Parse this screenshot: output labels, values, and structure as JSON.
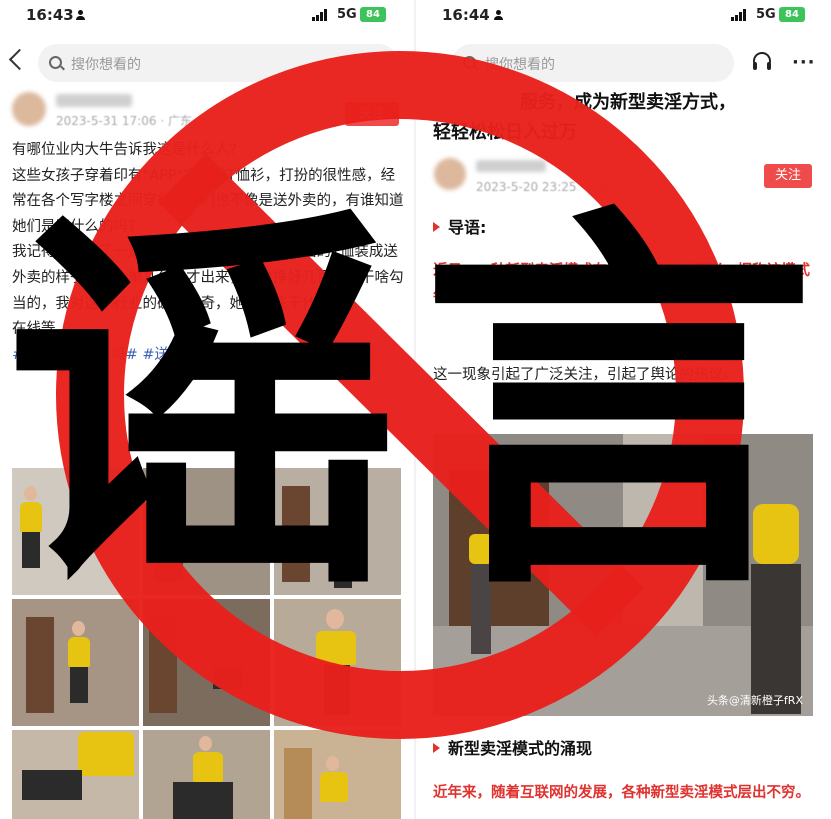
{
  "left_screen": {
    "status": {
      "time": "16:43",
      "network": "5G",
      "battery": "84"
    },
    "search": {
      "placeholder": "搜你想看的"
    },
    "post": {
      "meta": "2023-5-31 17:06 · 广东",
      "follow_label": "关注",
      "paragraphs": [
        "有哪位业内大牛告诉我这是什么人?",
        "这些女孩子穿着印有\"APP\"字样的T恤衫，打扮的很性感，经常在各个写字楼之间穿行，她们也不像是送外卖的，有谁知道她们是干什么的吗？",
        "我记得之前看了一则新闻，说有女孩子穿着美团的T恤装成送外卖的样子，送一单几分钟才出来，一单挣好几百实是干啥勾当的，我对这个行业的确是好奇，她们到底干什么的！",
        "在线等"
      ],
      "tags": "#送外卖你害羞吗# #送外卖，丢人? #女骑手#"
    }
  },
  "right_screen": {
    "status": {
      "time": "16:44",
      "network": "5G",
      "battery": "84"
    },
    "search": {
      "placeholder": "搜你想看的"
    },
    "article": {
      "title_line1": "服务，成为新型卖淫方式，",
      "title_line2": "轻轻松松日入过万",
      "meta": "2023-5-20 23:25 · 广东",
      "follow_label": "关注",
      "intro_heading": "导语:",
      "intro_red": "近日，一种新型卖淫模式在网络媒体上被曝光，据称该模式每天能让卖淫者轻松日入过万。",
      "intro_body": "这一现象引起了广泛关注，引起了舆论的热议。",
      "video_watermark": "头条@清新橙子fRX",
      "section_heading": "新型卖淫模式的涌现",
      "section_red": "近年来，随着互联网的发展，各种新型卖淫模式层出不穷。"
    }
  },
  "overlay": {
    "rumor_chars": [
      "谣",
      "言"
    ],
    "stamp_color": "#e8201c"
  }
}
